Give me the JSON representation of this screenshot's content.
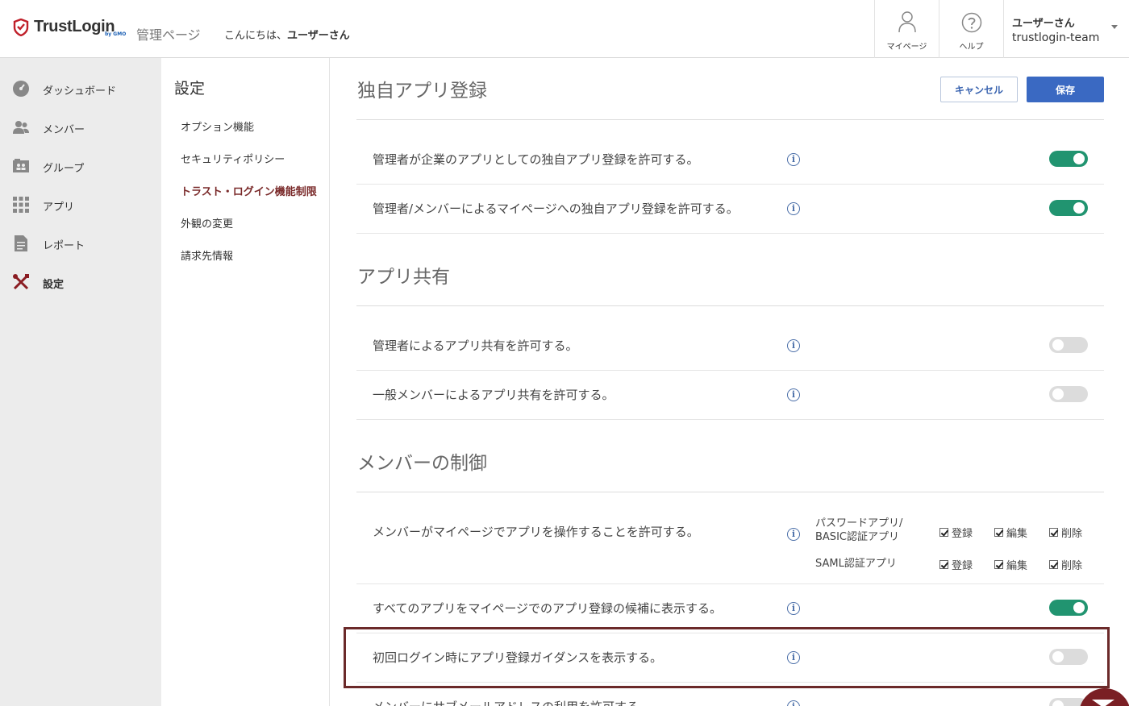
{
  "header": {
    "logo_text": "TrustLogin",
    "logo_sub": "by GMO",
    "admin_label": "管理ページ",
    "greeting_prefix": "こんにちは、",
    "greeting_user": "ユーザーさん",
    "mypage_label": "マイページ",
    "help_label": "ヘルプ",
    "user_name": "ユーザーさん",
    "user_team": "trustlogin-team"
  },
  "sidebar": {
    "items": [
      {
        "label": "ダッシュボード",
        "icon": "dashboard-icon"
      },
      {
        "label": "メンバー",
        "icon": "members-icon"
      },
      {
        "label": "グループ",
        "icon": "group-icon"
      },
      {
        "label": "アプリ",
        "icon": "apps-grid-icon"
      },
      {
        "label": "レポート",
        "icon": "report-icon"
      },
      {
        "label": "設定",
        "icon": "tools-icon",
        "active": true
      }
    ]
  },
  "subnav": {
    "title": "設定",
    "items": [
      {
        "label": "オプション機能"
      },
      {
        "label": "セキュリティポリシー"
      },
      {
        "label": "トラスト・ログイン機能制限",
        "active": true
      },
      {
        "label": "外観の変更"
      },
      {
        "label": "請求先情報"
      }
    ]
  },
  "actions": {
    "cancel_label": "キャンセル",
    "save_label": "保存"
  },
  "sections": [
    {
      "title": "独自アプリ登録",
      "rows": [
        {
          "label": "管理者が企業のアプリとしての独自アプリ登録を許可する。",
          "enabled": true
        },
        {
          "label": "管理者/メンバーによるマイページへの独自アプリ登録を許可する。",
          "enabled": true
        }
      ]
    },
    {
      "title": "アプリ共有",
      "rows": [
        {
          "label": "管理者によるアプリ共有を許可する。",
          "enabled": false
        },
        {
          "label": "一般メンバーによるアプリ共有を許可する。",
          "enabled": false
        }
      ]
    },
    {
      "title": "メンバーの制御",
      "rows": [
        {
          "label": "メンバーがマイページでアプリを操作することを許可する。",
          "permissions": [
            {
              "category_line1": "パスワードアプリ/",
              "category_line2": "BASIC認証アプリ",
              "options": [
                {
                  "label": "登録",
                  "checked": true
                },
                {
                  "label": "編集",
                  "checked": true
                },
                {
                  "label": "削除",
                  "checked": true
                }
              ]
            },
            {
              "category_line1": "SAML認証アプリ",
              "category_line2": "",
              "options": [
                {
                  "label": "登録",
                  "checked": true
                },
                {
                  "label": "編集",
                  "checked": true
                },
                {
                  "label": "削除",
                  "checked": true
                }
              ]
            }
          ]
        },
        {
          "label": "すべてのアプリをマイページでのアプリ登録の候補に表示する。",
          "enabled": true
        },
        {
          "label": "初回ログイン時にアプリ登録ガイダンスを表示する。",
          "enabled": false,
          "highlighted": true
        },
        {
          "label": "メンバーにサブメールアドレスの利用を許可する。",
          "enabled": false
        }
      ]
    }
  ],
  "info_glyph": "i",
  "colors": {
    "toggle_on": "#219470",
    "toggle_off": "#dcdcdc",
    "primary_button": "#3a69c2",
    "active_subnav": "#7a2a2a",
    "highlight_border": "#6b2a2a"
  }
}
